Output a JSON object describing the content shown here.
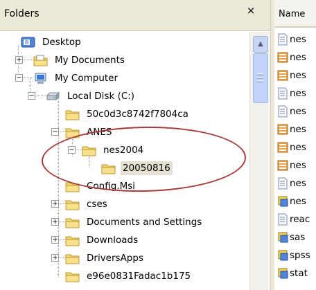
{
  "folders_pane": {
    "title": "Folders",
    "close_glyph": "×",
    "tree": [
      {
        "id": "desktop",
        "label": "Desktop",
        "icon": "desktop-icon",
        "expander": ""
      },
      {
        "id": "my-documents",
        "label": "My Documents",
        "icon": "my-documents-icon",
        "expander": "+"
      },
      {
        "id": "my-computer",
        "label": "My Computer",
        "icon": "my-computer-icon",
        "expander": "−"
      },
      {
        "id": "local-disk",
        "label": "Local Disk (C:)",
        "icon": "local-disk-icon",
        "expander": "−"
      },
      {
        "id": "folder-50c0",
        "label": "50c0d3c8742f7804ca",
        "icon": "folder-icon",
        "expander": ""
      },
      {
        "id": "anes",
        "label": "ANES",
        "icon": "folder-icon",
        "expander": "−"
      },
      {
        "id": "nes2004",
        "label": "nes2004",
        "icon": "folder-icon",
        "expander": "−"
      },
      {
        "id": "20050816",
        "label": "20050816",
        "icon": "folder-icon",
        "expander": ""
      },
      {
        "id": "config-msi",
        "label": "Config.Msi",
        "icon": "folder-icon",
        "expander": ""
      },
      {
        "id": "cses",
        "label": "cses",
        "icon": "folder-icon",
        "expander": "+"
      },
      {
        "id": "docs-settings",
        "label": "Documents and Settings",
        "icon": "folder-icon",
        "expander": "+"
      },
      {
        "id": "downloads",
        "label": "Downloads",
        "icon": "folder-icon",
        "expander": "+"
      },
      {
        "id": "driversapps",
        "label": "DriversApps",
        "icon": "folder-icon",
        "expander": "+"
      },
      {
        "id": "partial",
        "label": "e96e0831Fadac1b175",
        "icon": "folder-icon",
        "expander": ""
      }
    ]
  },
  "name_pane": {
    "header": "Name",
    "files": [
      {
        "label": "nes",
        "icon": "text-file-icon"
      },
      {
        "label": "nes",
        "icon": "data-file-icon"
      },
      {
        "label": "nes",
        "icon": "data-file-icon"
      },
      {
        "label": "nes",
        "icon": "text-file-icon"
      },
      {
        "label": "nes",
        "icon": "text-file-icon"
      },
      {
        "label": "nes",
        "icon": "data-file-icon"
      },
      {
        "label": "nes",
        "icon": "data-file-icon"
      },
      {
        "label": "nes",
        "icon": "data-file-icon"
      },
      {
        "label": "nes",
        "icon": "text-file-icon"
      },
      {
        "label": "nes",
        "icon": "program-file-icon"
      },
      {
        "label": "reac",
        "icon": "text-file-icon"
      },
      {
        "label": "sas",
        "icon": "program-file-icon"
      },
      {
        "label": "spss",
        "icon": "program-file-icon"
      },
      {
        "label": "stat",
        "icon": "program-file-icon"
      }
    ]
  },
  "colors": {
    "annotation": "#a63a3a",
    "folder": "#f4d36c",
    "header": "#ece9d8",
    "selection": "#e4e1d3"
  }
}
